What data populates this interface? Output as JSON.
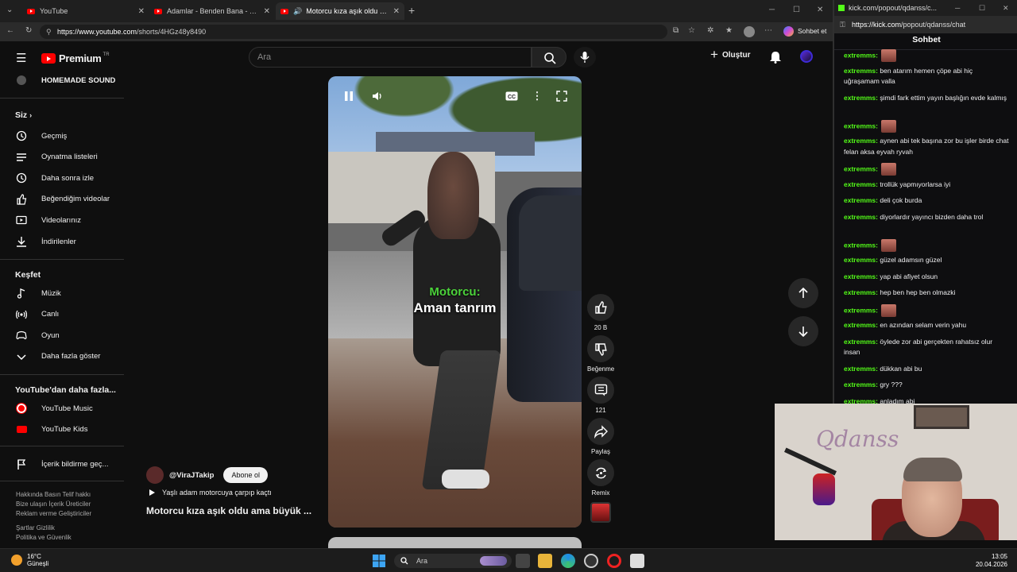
{
  "browser": {
    "tabs": [
      {
        "label": "YouTube"
      },
      {
        "label": "Adamlar - Benden Bana - YouTube"
      },
      {
        "label": "Motorcu kıza aşık oldu ama b"
      }
    ],
    "url_host": "https://www.youtube.com",
    "url_path": "/shorts/4HGz48y8490",
    "profile_action": "Sohbet et"
  },
  "youtube": {
    "logo_text": "Premium",
    "logo_region": "TR",
    "search_placeholder": "Ara",
    "create_label": "Oluştur",
    "sidebar": {
      "top_item": "HOMEMADE SOUND",
      "you_header": "Siz",
      "you_items": [
        {
          "label": "Geçmiş",
          "icon": "history-icon"
        },
        {
          "label": "Oynatma listeleri",
          "icon": "playlist-icon"
        },
        {
          "label": "Daha sonra izle",
          "icon": "clock-icon"
        },
        {
          "label": "Beğendiğim videolar",
          "icon": "thumbs-up-icon"
        },
        {
          "label": "Videolarınız",
          "icon": "video-icon"
        },
        {
          "label": "İndirilenler",
          "icon": "download-icon"
        }
      ],
      "explore_header": "Keşfet",
      "explore_items": [
        {
          "label": "Müzik",
          "icon": "music-icon"
        },
        {
          "label": "Canlı",
          "icon": "live-icon"
        },
        {
          "label": "Oyun",
          "icon": "gamepad-icon"
        },
        {
          "label": "Daha fazla göster",
          "icon": "chevron-down-icon"
        }
      ],
      "more_header": "YouTube'dan daha fazla...",
      "more_items": [
        {
          "label": "YouTube Music",
          "icon": "youtube-music-icon"
        },
        {
          "label": "YouTube Kids",
          "icon": "youtube-kids-icon"
        }
      ],
      "report_item": "İçerik bildirme geç...",
      "footer": [
        "Hakkında  Basın  Telif hakkı",
        "Bize ulaşın  İçerik Üreticiler",
        "Reklam verme  Geliştiriciler",
        "",
        "Şartlar  Gizlilik",
        "Politika ve Güvenlik"
      ]
    },
    "short": {
      "caption_speaker": "Motorcu:",
      "caption_line": "Aman tanrım",
      "channel": "@ViraJTakip",
      "subscribe_label": "Abone ol",
      "audio_label": "Yaşlı adam motorcuya çarpıp kaçtı",
      "title": "Motorcu kıza aşık oldu ama büyük ...",
      "actions": [
        {
          "label": "20 B",
          "icon": "like-icon"
        },
        {
          "label": "Beğenme",
          "icon": "dislike-icon"
        },
        {
          "label": "121",
          "icon": "comment-icon"
        },
        {
          "label": "Paylaş",
          "icon": "share-icon"
        },
        {
          "label": "Remix",
          "icon": "remix-icon"
        }
      ]
    }
  },
  "kick": {
    "tab_label": "kick.com/popout/qdanss/c...",
    "url_host": "https://kick.com",
    "url_path": "/popout/qdanss/chat",
    "chat_title": "Sohbet",
    "messages": [
      {
        "user": "extremms:",
        "text": "",
        "emote": true
      },
      {
        "user": "extremms:",
        "text": "ben atarım hemen çöpe abi hiç uğraşamam valla",
        "emote": false
      },
      {
        "user": "extremms:",
        "text": "şimdi fark ettim yayın başlığın evde kalmış",
        "emote": false
      },
      {
        "user": "extremms:",
        "text": "",
        "emote": true
      },
      {
        "user": "extremms:",
        "text": "aynen abi tek başına zor bu işler birde chat felan aksa eyvah ryvah",
        "emote": false
      },
      {
        "user": "extremms:",
        "text": "",
        "emote": true
      },
      {
        "user": "extremms:",
        "text": "trollük yapmıyorlarsa iyi",
        "emote": false
      },
      {
        "user": "extremms:",
        "text": "deli çok burda",
        "emote": false
      },
      {
        "user": "extremms:",
        "text": "diyorlardır yayıncı bizden daha trol",
        "emote": false
      },
      {
        "user": "extremms:",
        "text": "",
        "emote": true
      },
      {
        "user": "extremms:",
        "text": "güzel adamsın güzel",
        "emote": false
      },
      {
        "user": "extremms:",
        "text": "yap abi afiyet olsun",
        "emote": false
      },
      {
        "user": "extremms:",
        "text": "hep ben hep ben olmazki",
        "emote": false
      },
      {
        "user": "extremms:",
        "text": "",
        "emote": true
      },
      {
        "user": "extremms:",
        "text": "en azından selam verin yahu",
        "emote": false
      },
      {
        "user": "extremms:",
        "text": "öylede zor abi gerçekten rahatsız olur insan",
        "emote": false
      },
      {
        "user": "extremms:",
        "text": "dükkan abi bu",
        "emote": false
      },
      {
        "user": "extremms:",
        "text": "gry ???",
        "emote": false
      },
      {
        "user": "extremms:",
        "text": "anladım abi",
        "emote": false
      }
    ]
  },
  "webcam": {
    "overlay_text": "Qdanss"
  },
  "taskbar": {
    "temperature": "16°C",
    "weather": "Güneşli",
    "search": "Ara",
    "time": "13:05",
    "date": "20.04.2026"
  },
  "colors": {
    "yt_red": "#ff0000",
    "kick_green": "#53fc18",
    "caption_green": "#4bd23a"
  }
}
